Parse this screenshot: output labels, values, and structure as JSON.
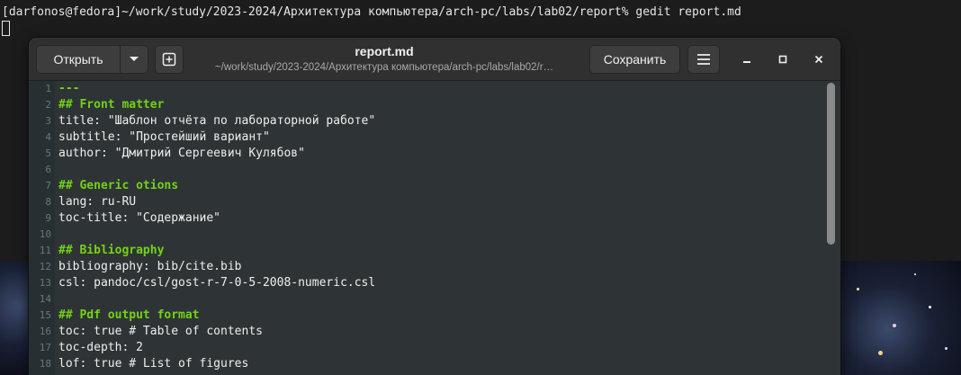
{
  "terminal": {
    "prompt_line": "[darfonos@fedora]~/work/study/2023-2024/Архитектура компьютера/arch-pc/labs/lab02/report% gedit report.md"
  },
  "window": {
    "title": "report.md",
    "subtitle": "~/work/study/2023-2024/Архитектура компьютера/arch-pc/labs/lab02/r…",
    "open_label": "Открыть",
    "save_label": "Сохранить"
  },
  "icons": {
    "open_menu": "chevron-down-icon",
    "new_tab": "new-document-icon",
    "menu": "hamburger-menu-icon",
    "minimize": "minimize-icon",
    "maximize": "maximize-icon",
    "close": "close-icon"
  },
  "editor": {
    "line_numbers": [
      "1",
      "2",
      "3",
      "4",
      "5",
      "6",
      "7",
      "8",
      "9",
      "10",
      "11",
      "12",
      "13",
      "14",
      "15",
      "16",
      "17",
      "18"
    ],
    "lines": [
      {
        "text": "---",
        "type": "heading"
      },
      {
        "text": "## Front matter",
        "type": "heading"
      },
      {
        "text": "title: \"Шаблон отчёта по лабораторной работе\"",
        "type": "text"
      },
      {
        "text": "subtitle: \"Простейший вариант\"",
        "type": "text"
      },
      {
        "text": "author: \"Дмитрий Сергеевич Кулябов\"",
        "type": "text"
      },
      {
        "text": "",
        "type": "text"
      },
      {
        "text": "## Generic otions",
        "type": "heading"
      },
      {
        "text": "lang: ru-RU",
        "type": "text"
      },
      {
        "text": "toc-title: \"Содержание\"",
        "type": "text"
      },
      {
        "text": "",
        "type": "text"
      },
      {
        "text": "## Bibliography",
        "type": "heading"
      },
      {
        "text": "bibliography: bib/cite.bib",
        "type": "text"
      },
      {
        "text": "csl: pandoc/csl/gost-r-7-0-5-2008-numeric.csl",
        "type": "text"
      },
      {
        "text": "",
        "type": "text"
      },
      {
        "text": "## Pdf output format",
        "type": "heading"
      },
      {
        "text": "toc: true # Table of contents",
        "type": "text"
      },
      {
        "text": "toc-depth: 2",
        "type": "text"
      },
      {
        "text": "lof: true # List of figures",
        "type": "text"
      }
    ]
  },
  "colors": {
    "heading": "#73d216",
    "editor_bg": "#2e3436",
    "headerbar_bg": "#303030"
  }
}
